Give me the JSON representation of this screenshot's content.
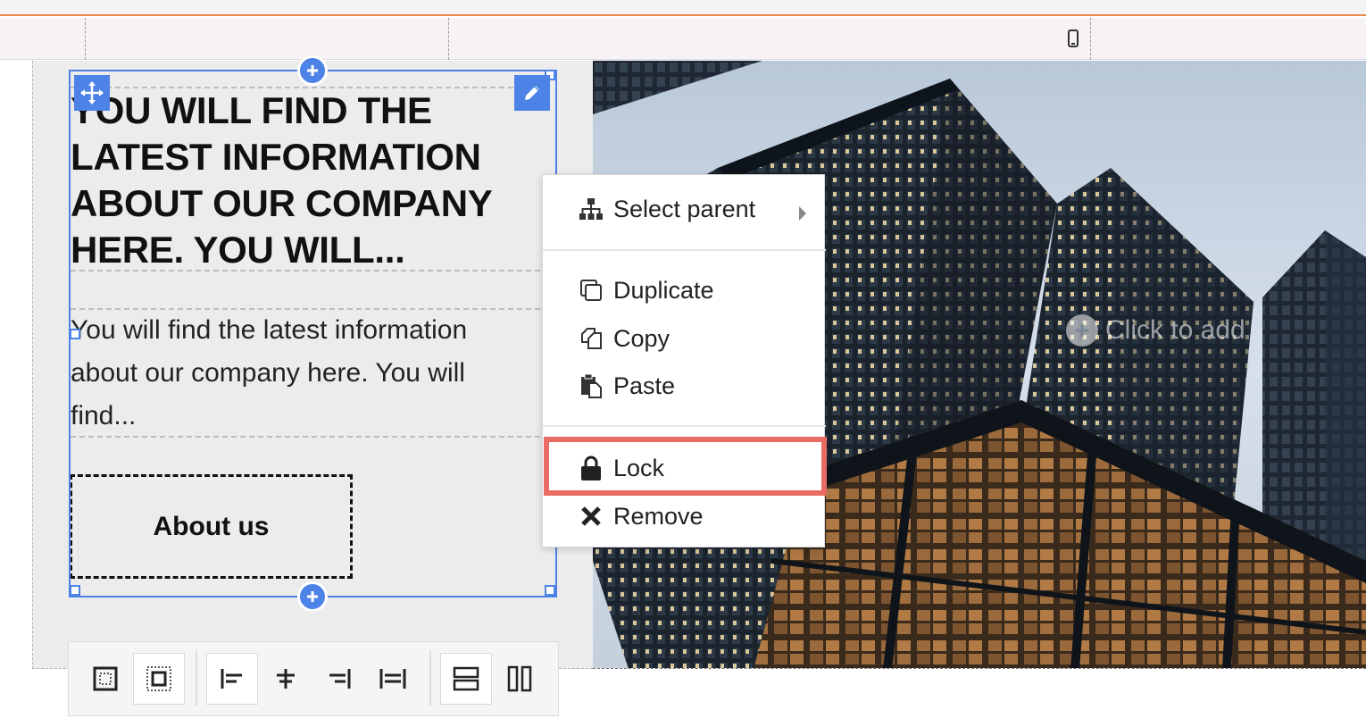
{
  "editor": {
    "device_icon": "mobile-phone-icon"
  },
  "content": {
    "heading": "YOU WILL FIND THE LATEST INFORMATION ABOUT OUR COMPANY HERE. YOU WILL...",
    "paragraph": "You will find the latest information about our company here. You will find...",
    "button_label": "About us"
  },
  "image_overlay": {
    "click_to_add": "Click to add",
    "icon": "plus-circle-icon"
  },
  "context_menu": {
    "items": [
      {
        "label": "Select parent",
        "icon": "sitemap-icon",
        "has_submenu": true
      },
      {
        "label": "Duplicate",
        "icon": "duplicate-icon"
      },
      {
        "label": "Copy",
        "icon": "copy-icon"
      },
      {
        "label": "Paste",
        "icon": "paste-icon"
      },
      {
        "label": "Lock",
        "icon": "lock-icon",
        "highlighted": true
      },
      {
        "label": "Remove",
        "icon": "remove-x-icon"
      }
    ]
  },
  "bottom_toolbar": {
    "buttons": [
      {
        "icon": "padding-inner-icon"
      },
      {
        "icon": "padding-outer-icon"
      },
      {
        "icon": "align-left-icon"
      },
      {
        "icon": "align-center-icon"
      },
      {
        "icon": "align-right-icon"
      },
      {
        "icon": "align-justify-icon"
      },
      {
        "icon": "layout-rows-icon"
      },
      {
        "icon": "layout-columns-icon"
      }
    ]
  },
  "colors": {
    "selection": "#4d82e6",
    "highlight": "#ea6b64",
    "accent_top": "#e8894a"
  }
}
